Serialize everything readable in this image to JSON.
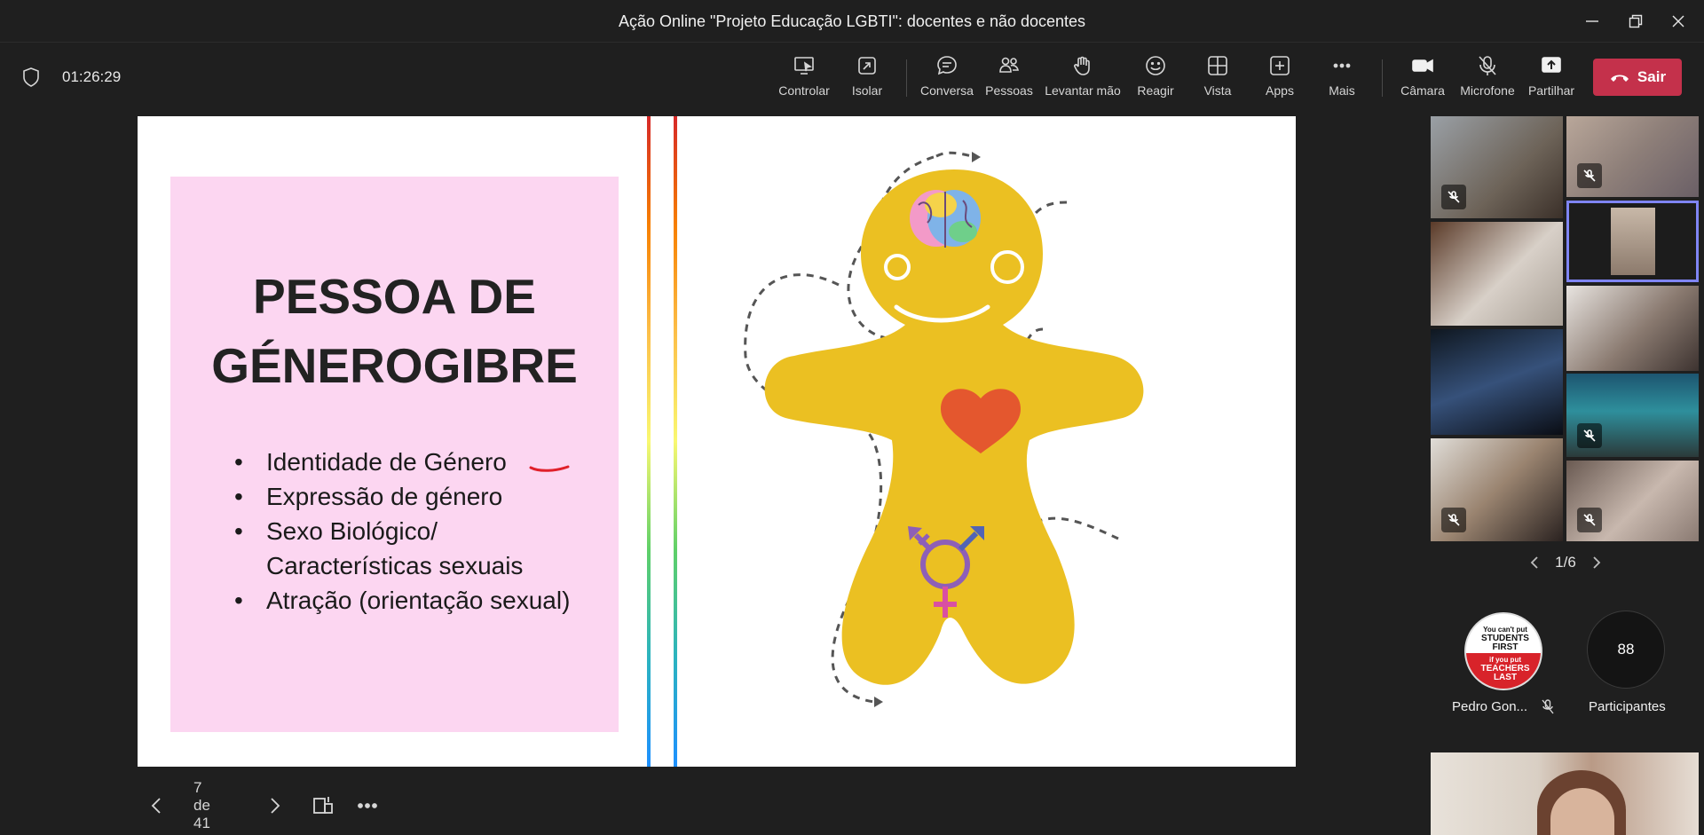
{
  "window": {
    "title": "Ação Online \"Projeto Educação LGBTI\": docentes e não docentes"
  },
  "meeting": {
    "timer": "01:26:29"
  },
  "toolbar": {
    "controlar": "Controlar",
    "isolar": "Isolar",
    "conversa": "Conversa",
    "pessoas": "Pessoas",
    "levantar": "Levantar mão",
    "reagir": "Reagir",
    "vista": "Vista",
    "apps": "Apps",
    "mais": "Mais",
    "camara": "Câmara",
    "microfone": "Microfone",
    "partilhar": "Partilhar",
    "sair": "Sair"
  },
  "slide": {
    "title_line1": "PESSOA DE",
    "title_line2": "GÉNEROGIBRE",
    "bullets": [
      "Identidade de Género",
      "Expressão de género",
      "Sexo Biológico/ Características sexuais",
      "Atração (orientação sexual)"
    ]
  },
  "slide_nav": {
    "position": "7 de 41"
  },
  "gallery": {
    "page": "1/6"
  },
  "participants": {
    "pinned_name": "Pedro Gon...",
    "pinned_avatar_text": [
      "You can't put",
      "STUDENTS",
      "FIRST",
      "if you put",
      "TEACHERS",
      "LAST"
    ],
    "count": "88",
    "count_label": "Participantes"
  },
  "colors": {
    "leave_button": "#c4314b",
    "slide_pink": "#fcd6f1",
    "gingerbread": "#ebc022",
    "selected_tile": "#7f85f5"
  }
}
